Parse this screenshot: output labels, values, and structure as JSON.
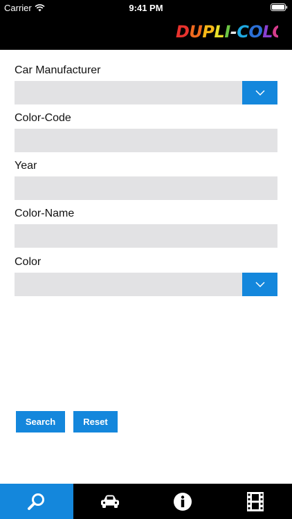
{
  "status_bar": {
    "carrier": "Carrier",
    "time": "9:41 PM"
  },
  "header": {
    "logo_text": "DUPLI-COLOR"
  },
  "form": {
    "car_manufacturer_label": "Car Manufacturer",
    "color_code_label": "Color-Code",
    "year_label": "Year",
    "color_name_label": "Color-Name",
    "color_label": "Color"
  },
  "buttons": {
    "search_label": "Search",
    "reset_label": "Reset"
  },
  "tabs": [
    {
      "name": "search-icon"
    },
    {
      "name": "car-icon"
    },
    {
      "name": "info-icon"
    },
    {
      "name": "film-icon"
    }
  ],
  "colors": {
    "accent": "#1487dc",
    "field_bg": "#e2e2e4",
    "header_bg": "#000000"
  }
}
